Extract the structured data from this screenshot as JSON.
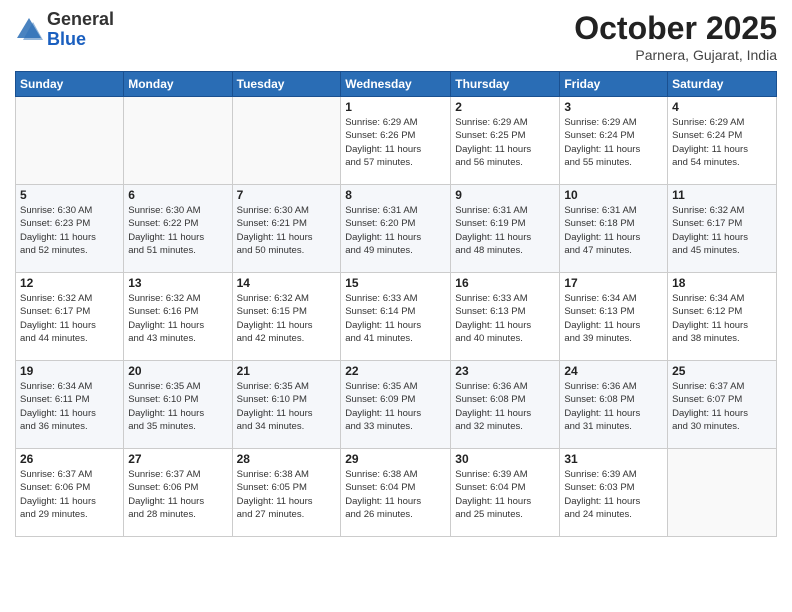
{
  "header": {
    "logo_general": "General",
    "logo_blue": "Blue",
    "month": "October 2025",
    "location": "Parnera, Gujarat, India"
  },
  "days_of_week": [
    "Sunday",
    "Monday",
    "Tuesday",
    "Wednesday",
    "Thursday",
    "Friday",
    "Saturday"
  ],
  "weeks": [
    [
      {
        "day": "",
        "info": ""
      },
      {
        "day": "",
        "info": ""
      },
      {
        "day": "",
        "info": ""
      },
      {
        "day": "1",
        "info": "Sunrise: 6:29 AM\nSunset: 6:26 PM\nDaylight: 11 hours\nand 57 minutes."
      },
      {
        "day": "2",
        "info": "Sunrise: 6:29 AM\nSunset: 6:25 PM\nDaylight: 11 hours\nand 56 minutes."
      },
      {
        "day": "3",
        "info": "Sunrise: 6:29 AM\nSunset: 6:24 PM\nDaylight: 11 hours\nand 55 minutes."
      },
      {
        "day": "4",
        "info": "Sunrise: 6:29 AM\nSunset: 6:24 PM\nDaylight: 11 hours\nand 54 minutes."
      }
    ],
    [
      {
        "day": "5",
        "info": "Sunrise: 6:30 AM\nSunset: 6:23 PM\nDaylight: 11 hours\nand 52 minutes."
      },
      {
        "day": "6",
        "info": "Sunrise: 6:30 AM\nSunset: 6:22 PM\nDaylight: 11 hours\nand 51 minutes."
      },
      {
        "day": "7",
        "info": "Sunrise: 6:30 AM\nSunset: 6:21 PM\nDaylight: 11 hours\nand 50 minutes."
      },
      {
        "day": "8",
        "info": "Sunrise: 6:31 AM\nSunset: 6:20 PM\nDaylight: 11 hours\nand 49 minutes."
      },
      {
        "day": "9",
        "info": "Sunrise: 6:31 AM\nSunset: 6:19 PM\nDaylight: 11 hours\nand 48 minutes."
      },
      {
        "day": "10",
        "info": "Sunrise: 6:31 AM\nSunset: 6:18 PM\nDaylight: 11 hours\nand 47 minutes."
      },
      {
        "day": "11",
        "info": "Sunrise: 6:32 AM\nSunset: 6:17 PM\nDaylight: 11 hours\nand 45 minutes."
      }
    ],
    [
      {
        "day": "12",
        "info": "Sunrise: 6:32 AM\nSunset: 6:17 PM\nDaylight: 11 hours\nand 44 minutes."
      },
      {
        "day": "13",
        "info": "Sunrise: 6:32 AM\nSunset: 6:16 PM\nDaylight: 11 hours\nand 43 minutes."
      },
      {
        "day": "14",
        "info": "Sunrise: 6:32 AM\nSunset: 6:15 PM\nDaylight: 11 hours\nand 42 minutes."
      },
      {
        "day": "15",
        "info": "Sunrise: 6:33 AM\nSunset: 6:14 PM\nDaylight: 11 hours\nand 41 minutes."
      },
      {
        "day": "16",
        "info": "Sunrise: 6:33 AM\nSunset: 6:13 PM\nDaylight: 11 hours\nand 40 minutes."
      },
      {
        "day": "17",
        "info": "Sunrise: 6:34 AM\nSunset: 6:13 PM\nDaylight: 11 hours\nand 39 minutes."
      },
      {
        "day": "18",
        "info": "Sunrise: 6:34 AM\nSunset: 6:12 PM\nDaylight: 11 hours\nand 38 minutes."
      }
    ],
    [
      {
        "day": "19",
        "info": "Sunrise: 6:34 AM\nSunset: 6:11 PM\nDaylight: 11 hours\nand 36 minutes."
      },
      {
        "day": "20",
        "info": "Sunrise: 6:35 AM\nSunset: 6:10 PM\nDaylight: 11 hours\nand 35 minutes."
      },
      {
        "day": "21",
        "info": "Sunrise: 6:35 AM\nSunset: 6:10 PM\nDaylight: 11 hours\nand 34 minutes."
      },
      {
        "day": "22",
        "info": "Sunrise: 6:35 AM\nSunset: 6:09 PM\nDaylight: 11 hours\nand 33 minutes."
      },
      {
        "day": "23",
        "info": "Sunrise: 6:36 AM\nSunset: 6:08 PM\nDaylight: 11 hours\nand 32 minutes."
      },
      {
        "day": "24",
        "info": "Sunrise: 6:36 AM\nSunset: 6:08 PM\nDaylight: 11 hours\nand 31 minutes."
      },
      {
        "day": "25",
        "info": "Sunrise: 6:37 AM\nSunset: 6:07 PM\nDaylight: 11 hours\nand 30 minutes."
      }
    ],
    [
      {
        "day": "26",
        "info": "Sunrise: 6:37 AM\nSunset: 6:06 PM\nDaylight: 11 hours\nand 29 minutes."
      },
      {
        "day": "27",
        "info": "Sunrise: 6:37 AM\nSunset: 6:06 PM\nDaylight: 11 hours\nand 28 minutes."
      },
      {
        "day": "28",
        "info": "Sunrise: 6:38 AM\nSunset: 6:05 PM\nDaylight: 11 hours\nand 27 minutes."
      },
      {
        "day": "29",
        "info": "Sunrise: 6:38 AM\nSunset: 6:04 PM\nDaylight: 11 hours\nand 26 minutes."
      },
      {
        "day": "30",
        "info": "Sunrise: 6:39 AM\nSunset: 6:04 PM\nDaylight: 11 hours\nand 25 minutes."
      },
      {
        "day": "31",
        "info": "Sunrise: 6:39 AM\nSunset: 6:03 PM\nDaylight: 11 hours\nand 24 minutes."
      },
      {
        "day": "",
        "info": ""
      }
    ]
  ]
}
